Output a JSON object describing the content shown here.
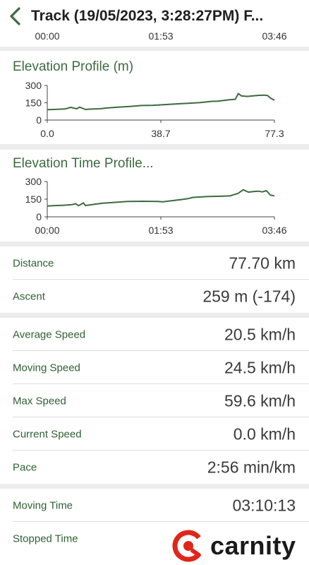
{
  "header": {
    "back_icon": "chevron-left-icon",
    "title": "Track (19/05/2023, 3:28:27PM) F..."
  },
  "top_axis": {
    "ticks": [
      "00:00",
      "01:53",
      "03:46"
    ]
  },
  "elevation_profile": {
    "title": "Elevation Profile (m)",
    "chart_data": {
      "type": "line",
      "title": "Elevation Profile (m)",
      "y_ticks": [
        "300",
        "150",
        "0"
      ],
      "x_ticks": [
        "0.0",
        "38.7",
        "77.3"
      ],
      "ylim": [
        0,
        300
      ],
      "xlim": [
        0,
        77.3
      ],
      "color": "#3c6b3e",
      "x": [
        0,
        2,
        4,
        6,
        8,
        10,
        11,
        13,
        14,
        16,
        18,
        20,
        22,
        24,
        28,
        30,
        32,
        36,
        40,
        44,
        48,
        52,
        56,
        58,
        60,
        62,
        64,
        65,
        66,
        68,
        70,
        72,
        74,
        75,
        76,
        77.3
      ],
      "y": [
        90,
        92,
        94,
        96,
        110,
        98,
        112,
        92,
        94,
        96,
        98,
        104,
        108,
        112,
        118,
        122,
        126,
        128,
        134,
        140,
        146,
        152,
        162,
        164,
        170,
        176,
        180,
        230,
        210,
        205,
        210,
        214,
        216,
        212,
        190,
        172
      ]
    }
  },
  "elevation_time_profile": {
    "title": "Elevation Time Profile...",
    "chart_data": {
      "type": "line",
      "title": "Elevation Time Profile...",
      "y_ticks": [
        "300",
        "150",
        "0"
      ],
      "x_ticks": [
        "00:00",
        "01:53",
        "03:46"
      ],
      "ylim": [
        0,
        300
      ],
      "xlim": [
        0,
        226
      ],
      "color": "#3c6b3e",
      "x": [
        0,
        5,
        10,
        15,
        20,
        25,
        28,
        31,
        34,
        36,
        38,
        42,
        48,
        55,
        65,
        80,
        95,
        110,
        115,
        125,
        135,
        140,
        145,
        160,
        175,
        182,
        190,
        195,
        200,
        205,
        210,
        214,
        218,
        222,
        226
      ],
      "y": [
        92,
        94,
        96,
        98,
        100,
        104,
        112,
        95,
        108,
        118,
        96,
        100,
        108,
        116,
        122,
        130,
        132,
        130,
        128,
        138,
        148,
        155,
        165,
        172,
        176,
        178,
        200,
        230,
        210,
        215,
        218,
        212,
        222,
        185,
        178
      ]
    }
  },
  "stats_group_1": [
    {
      "label": "Distance",
      "value": "77.70 km"
    },
    {
      "label": "Ascent",
      "value": "259 m (-174)"
    }
  ],
  "stats_group_2": [
    {
      "label": "Average Speed",
      "value": "20.5 km/h"
    },
    {
      "label": "Moving Speed",
      "value": "24.5 km/h"
    },
    {
      "label": "Max Speed",
      "value": "59.6 km/h"
    },
    {
      "label": "Current Speed",
      "value": "0.0 km/h"
    },
    {
      "label": "Pace",
      "value": "2:56 min/km"
    }
  ],
  "stats_group_3": [
    {
      "label": "Moving Time",
      "value": "03:10:13"
    },
    {
      "label": "Stopped Time",
      "value": ""
    }
  ],
  "watermark": {
    "text": "carnity",
    "icon": "carnity-logo-icon",
    "color": "#e0261b"
  }
}
